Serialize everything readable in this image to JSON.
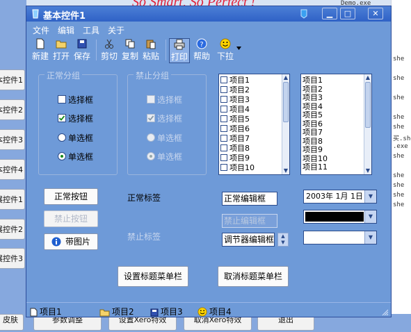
{
  "background": {
    "brand_text": "So Smart, So Perfect !",
    "log_top": "Demo.exe",
    "log_lines": [
      "she",
      "she",
      "she",
      "she",
      "she",
      "买.she",
      ".exe",
      "she",
      "she",
      "she",
      "she",
      "she"
    ],
    "left_buttons": [
      "本控件1",
      "本控件2",
      "本控件3",
      "本控件4",
      "展控件1",
      "展控件2",
      "展控件3"
    ],
    "bottom_buttons": [
      "皮肤",
      "参数调整",
      "设置Xero特效",
      "取消Xero特效",
      "退出"
    ]
  },
  "window": {
    "title": "基本控件1",
    "minimize": "▁",
    "maximize": "□",
    "close": "✕",
    "menus": [
      "文件",
      "编辑",
      "工具",
      "关于"
    ],
    "toolbar": [
      "新建",
      "打开",
      "保存",
      "剪切",
      "复制",
      "粘贴",
      "打印",
      "帮助",
      "下拉"
    ],
    "groups": {
      "normal": {
        "title": "正常分组",
        "checkbox1": "选择框",
        "checkbox2": "选择框",
        "radio1": "单选框",
        "radio2": "单选框"
      },
      "disabled": {
        "title": "禁止分组",
        "checkbox1": "选择框",
        "checkbox2": "选择框",
        "radio1": "单选框",
        "radio2": "单选框"
      }
    },
    "list_left": [
      "项目1",
      "项目2",
      "项目3",
      "项目4",
      "项目5",
      "项目6",
      "项目7",
      "项目8",
      "项目9",
      "项目10"
    ],
    "list_right": [
      "项目1",
      "项目2",
      "项目3",
      "项目4",
      "项目5",
      "项目6",
      "项目7",
      "项目8",
      "项目9",
      "项目10",
      "项目11"
    ],
    "buttons": {
      "normal": "正常按钮",
      "disabled": "禁止按钮",
      "image": "带图片",
      "set_title_menu": "设置标题菜单栏",
      "cancel_title_menu": "取消标题菜单栏"
    },
    "labels": {
      "normal": "正常标签",
      "disabled": "禁止标签"
    },
    "edits": {
      "normal": "正常编辑框",
      "disabled": "禁止编辑框",
      "spin": "调节器编辑框"
    },
    "date": "2003年 1月 1日",
    "status": [
      "项目1",
      "项目2",
      "项目3",
      "项目4"
    ],
    "colors": {
      "title_bar": "#2f62c6",
      "window_bg": "#6e9ad8",
      "combo_black": "#000000"
    }
  }
}
